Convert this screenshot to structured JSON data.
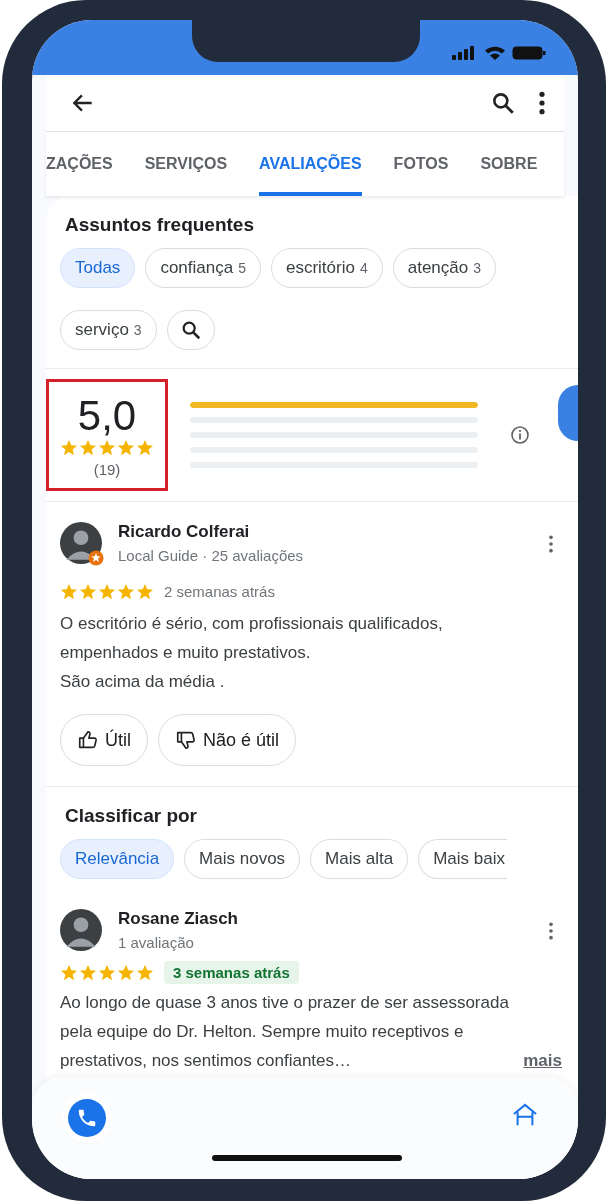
{
  "tabs": [
    {
      "label": "ZAÇÕES",
      "selected": false
    },
    {
      "label": "SERVIÇOS",
      "selected": false
    },
    {
      "label": "AVALIAÇÕES",
      "selected": true
    },
    {
      "label": "FOTOS",
      "selected": false
    },
    {
      "label": "SOBRE",
      "selected": false
    }
  ],
  "topics": {
    "title": "Assuntos frequentes",
    "chips": [
      {
        "label": "Todas",
        "selected": true
      },
      {
        "label": "confiança",
        "count": "5",
        "selected": false
      },
      {
        "label": "escritório",
        "count": "4",
        "selected": false
      },
      {
        "label": "atenção",
        "count": "3",
        "selected": false
      },
      {
        "label": "serviço",
        "count": "3",
        "selected": false
      }
    ]
  },
  "rating": {
    "score": "5,0",
    "stars": 5,
    "count": "(19)",
    "highlighted": true,
    "bars": [
      {
        "level": 1
      },
      {
        "level": 0
      },
      {
        "level": 0
      },
      {
        "level": 0
      },
      {
        "level": 0
      }
    ]
  },
  "feed": [
    {
      "kind": "review",
      "name": "Ricardo Colferai",
      "local_guide": true,
      "meta": "Local Guide · 25 avaliações",
      "stars": 5,
      "time": "2 semanas atrás",
      "time_highlighted": false,
      "text": "O escritório é sério, com profissionais qualificados, empenhados e muito prestativos.\nSão acima da média .",
      "actions": [
        "Útil",
        "Não é útil"
      ]
    },
    {
      "kind": "sort",
      "title": "Classificar por",
      "chips": [
        {
          "label": "Relevância",
          "selected": true
        },
        {
          "label": "Mais novos",
          "selected": false
        },
        {
          "label": "Mais alta",
          "selected": false
        },
        {
          "label": "Mais baix",
          "selected": false
        }
      ]
    },
    {
      "kind": "review",
      "name": "Rosane Ziasch",
      "local_guide": false,
      "meta": "1 avaliação",
      "stars": 5,
      "time": "3 semanas atrás",
      "time_highlighted": true,
      "text": "Ao longo de quase 3 anos tive o prazer de ser assessorada pela equipe do Dr. Helton. Sempre muito receptivos e prestativos, nos sentimos confiantes…",
      "more": "mais"
    }
  ]
}
